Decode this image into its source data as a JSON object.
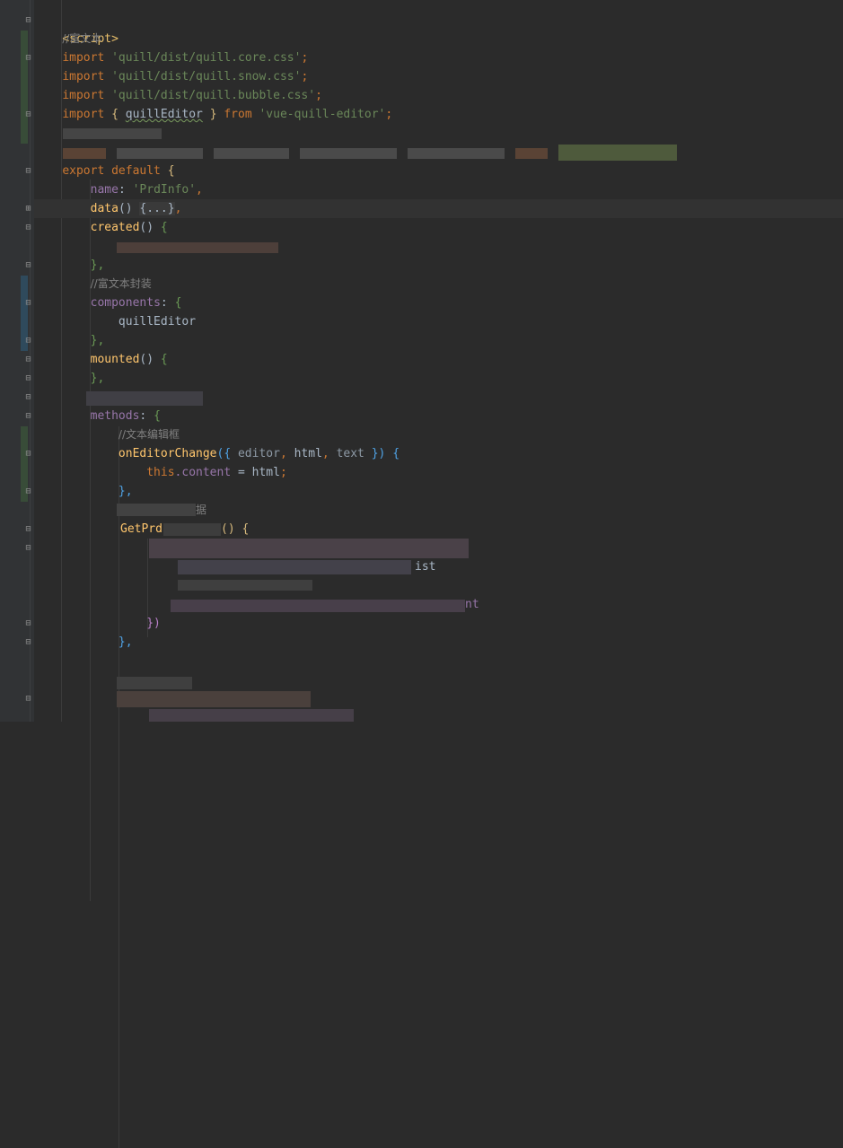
{
  "code": {
    "l1_tag": "<script>",
    "l2_comment": "//富文本",
    "l3_kw": "import",
    "l3_str": "'quill/dist/quill.core.css'",
    "l4_kw": "import",
    "l4_str": "'quill/dist/quill.snow.css'",
    "l5_kw": "import",
    "l5_str": "'quill/dist/quill.bubble.css'",
    "l6_kw": "import",
    "l6_open": "{",
    "l6_name": "quillEditor",
    "l6_close": "}",
    "l6_from": "from",
    "l6_str": "'vue-quill-editor'",
    "l9_kw": "export default",
    "l9_brace": "{",
    "l10_prop": "name",
    "l10_colon": ":",
    "l10_str": "'PrdInfo'",
    "l10_comma": ",",
    "l11_fn": "data",
    "l11_paren": "()",
    "l11_collapsed": "{...}",
    "l11_comma": ",",
    "l12_fn": "created",
    "l12_paren": "()",
    "l12_brace": "{",
    "l14_close": "},",
    "l15_comment": "//富文本封装",
    "l16_prop": "components",
    "l16_colon": ":",
    "l16_brace": "{",
    "l17_name": "quillEditor",
    "l18_close": "},",
    "l19_fn": "mounted",
    "l19_paren": "()",
    "l19_brace": "{",
    "l20_close": "},",
    "l22_prop": "methods",
    "l22_colon": ":",
    "l22_brace": "{",
    "l23_comment": "//文本编辑框",
    "l24_fn": "onEditorChange",
    "l24_open": "({",
    "l24_p1": "editor",
    "l24_p2": "html",
    "l24_p3": "text",
    "l24_close": "})",
    "l24_brace": "{",
    "l25_this": "this",
    "l25_prop": ".content",
    "l25_eq": " = ",
    "l25_val": "html",
    "l25_semi": ";",
    "l26_close": "},",
    "l27_partial": "据",
    "l28_partial": "GetPrd",
    "l28_tail": "() {",
    "l30_partial": "ist",
    "l32_partial": "nt",
    "l33_close": "})",
    "l34_close": "},"
  },
  "colors": {
    "background": "#2b2b2b",
    "gutter": "#313335",
    "keyword": "#cc7832",
    "string": "#6a8759",
    "comment": "#808080",
    "function": "#ffc66d",
    "property": "#9876aa",
    "change_marker_green": "#384c38",
    "change_marker_blue": "#2f4a5c"
  },
  "icons": {
    "fold_marker": "fold-marker-icon"
  }
}
